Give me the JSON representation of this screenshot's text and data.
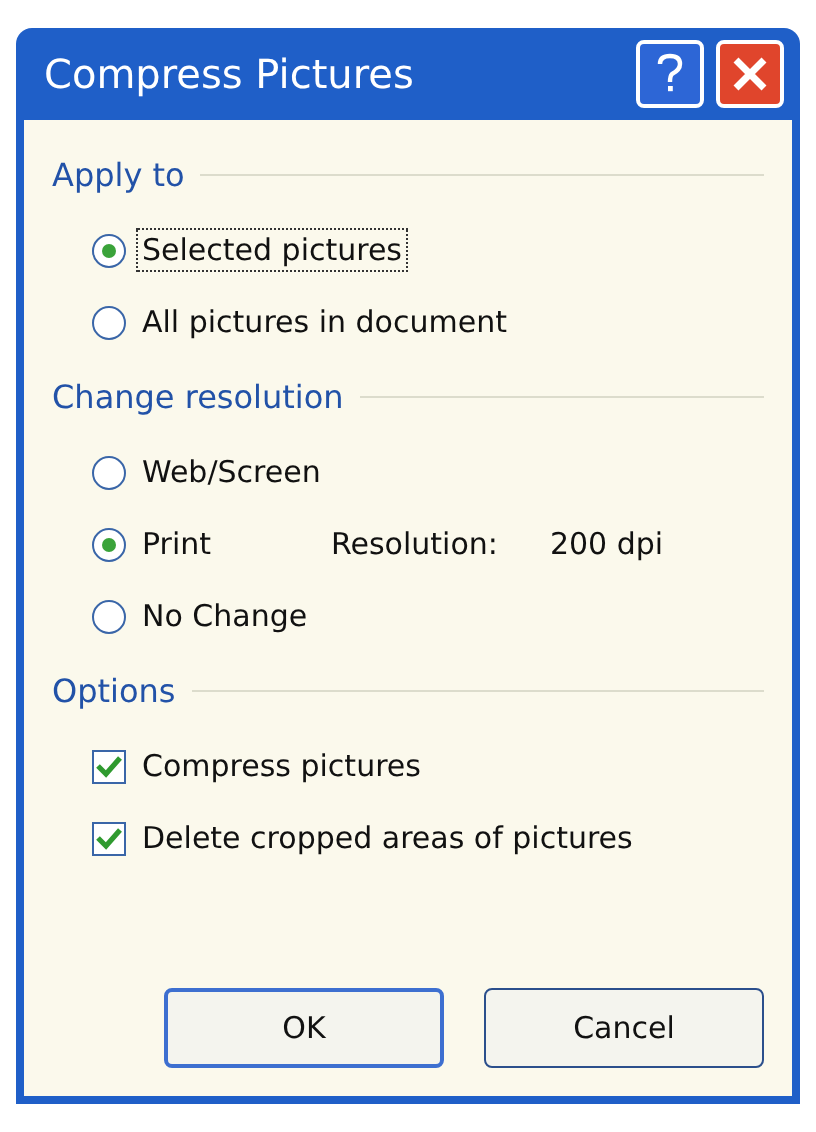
{
  "window": {
    "title": "Compress Pictures"
  },
  "sections": [
    {
      "title": "Apply to",
      "items": [
        {
          "kind": "radio",
          "label": "Selected pictures",
          "selected": true,
          "focused": true
        },
        {
          "kind": "radio",
          "label": "All pictures in document",
          "selected": false,
          "focused": false
        }
      ]
    },
    {
      "title": "Change resolution",
      "items": [
        {
          "kind": "radio",
          "label": "Web/Screen",
          "selected": false,
          "focused": false
        },
        {
          "kind": "radio",
          "label": "Print",
          "selected": true,
          "focused": false,
          "resolution_label": "Resolution:",
          "resolution_value": "200 dpi"
        },
        {
          "kind": "radio",
          "label": "No Change",
          "selected": false,
          "focused": false
        }
      ]
    },
    {
      "title": "Options",
      "items": [
        {
          "kind": "checkbox",
          "label": "Compress pictures",
          "checked": true
        },
        {
          "kind": "checkbox",
          "label": "Delete cropped areas of pictures",
          "checked": true
        }
      ]
    }
  ],
  "buttons": [
    {
      "label": "OK",
      "default": true
    },
    {
      "label": "Cancel",
      "default": false
    }
  ]
}
